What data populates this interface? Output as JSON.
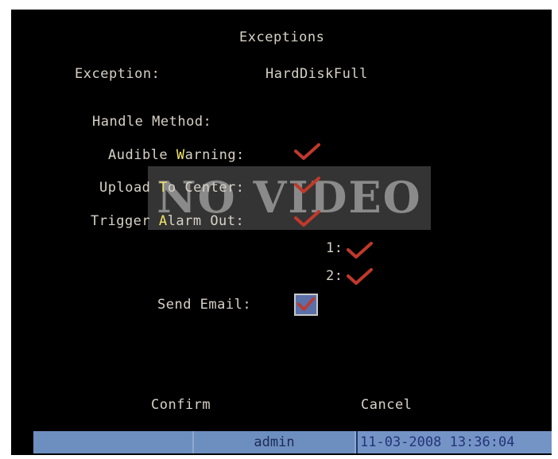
{
  "window": {
    "title": "Exceptions"
  },
  "exception": {
    "label": "Exception:",
    "value": "HardDiskFull"
  },
  "handle_method": {
    "label": "Handle Method:"
  },
  "options": {
    "audible_warning": {
      "label_a": "Audible ",
      "label_hl": "W",
      "label_b": "arning:",
      "checked": true
    },
    "upload_to_center": {
      "label_a": "Upload ",
      "label_hl": "T",
      "label_b": "o Center:",
      "checked": true
    },
    "trigger_alarm_out": {
      "label_a": "Trigger ",
      "label_hl": "A",
      "label_b": "larm Out:",
      "checked": true
    },
    "alarm_out_1": {
      "label": "1:",
      "checked": true
    },
    "alarm_out_2": {
      "label": "2:",
      "checked": true
    },
    "send_email": {
      "label": "Send Email:",
      "checked": true
    }
  },
  "overlay": {
    "no_video": "NO VIDEO"
  },
  "buttons": {
    "confirm": "Confirm",
    "cancel": "Cancel"
  },
  "statusbar": {
    "user": "admin",
    "datetime": "11-03-2008 13:36:04"
  },
  "colors": {
    "background": "#000000",
    "text": "#d8d2c6",
    "hotkey": "#f1e66a",
    "check": "#c0392b",
    "statusbar": "#6d8fc0"
  }
}
